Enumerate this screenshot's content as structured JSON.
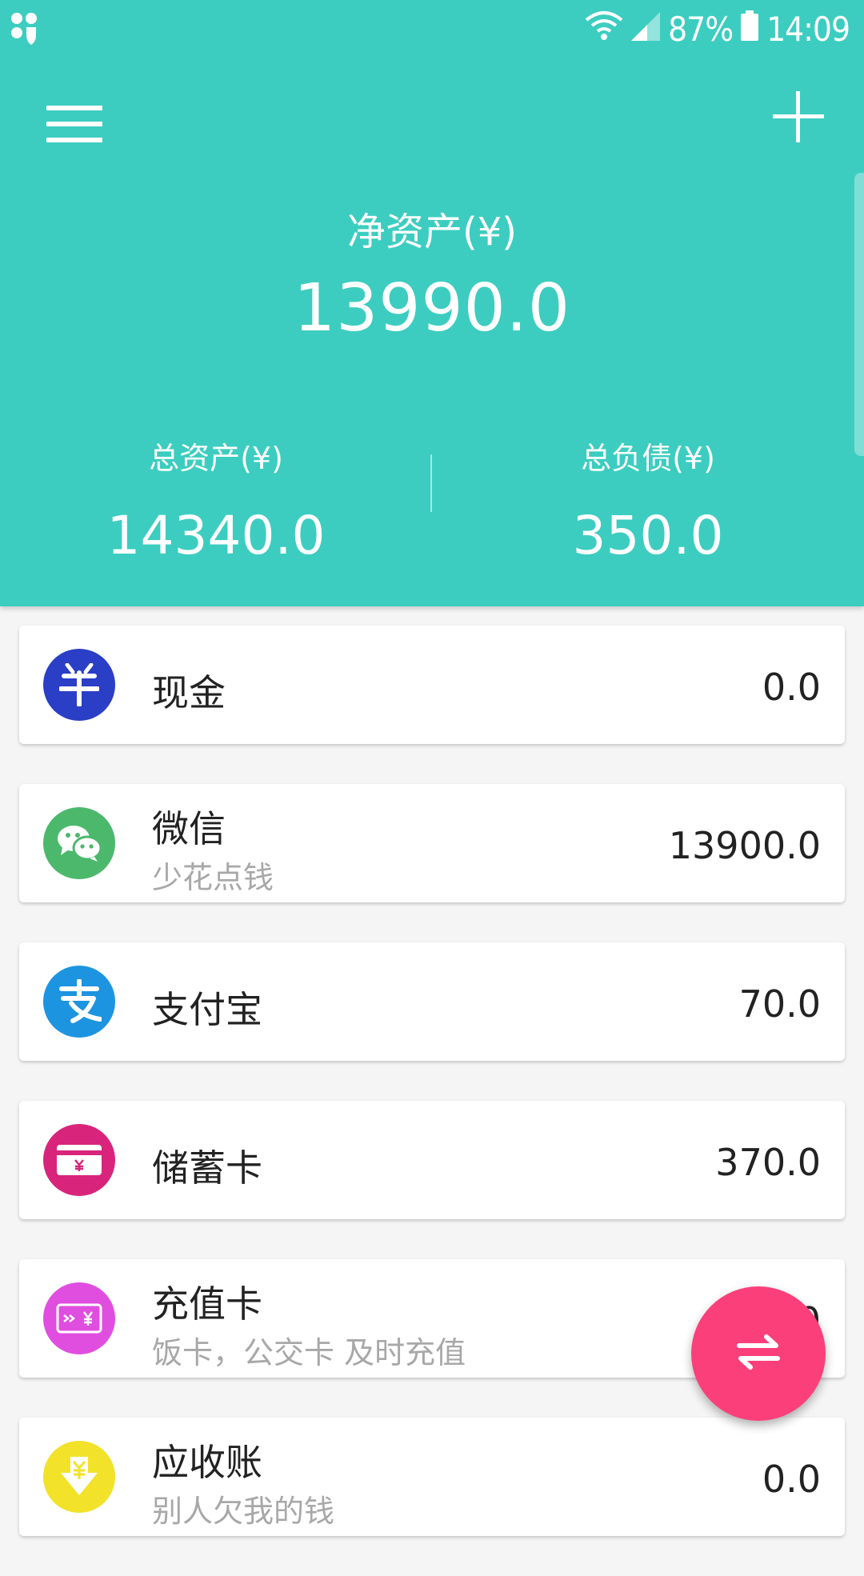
{
  "status_bar": {
    "battery_text": "87%",
    "time": "14:09",
    "icons": [
      "app-notification-icon",
      "wifi-icon",
      "signal-icon",
      "battery-icon"
    ]
  },
  "header": {
    "menu_icon": "hamburger-menu-icon",
    "add_icon": "plus-icon",
    "net_assets_label": "净资产(¥)",
    "net_assets_value": "13990.0",
    "total_assets_label": "总资产(¥)",
    "total_assets_value": "14340.0",
    "total_liabilities_label": "总负债(¥)",
    "total_liabilities_value": "350.0"
  },
  "accounts": [
    {
      "name": "现金",
      "desc": "",
      "amount": "0.0",
      "icon": "cash-icon",
      "color": "#2a3fc6"
    },
    {
      "name": "微信",
      "desc": "少花点钱",
      "amount": "13900.0",
      "icon": "wechat-icon",
      "color": "#4cb86c"
    },
    {
      "name": "支付宝",
      "desc": "",
      "amount": "70.0",
      "icon": "alipay-icon",
      "color": "#1d94e0"
    },
    {
      "name": "储蓄卡",
      "desc": "",
      "amount": "370.0",
      "icon": "debit-card-icon",
      "color": "#d8257b"
    },
    {
      "name": "充值卡",
      "desc": "饭卡，公交卡 及时充值",
      "amount": "0.0",
      "icon": "prepaid-card-icon",
      "color": "#e04ee0"
    },
    {
      "name": "应收账",
      "desc": "别人欠我的钱",
      "amount": "0.0",
      "icon": "receivable-icon",
      "color": "#f2e22a"
    }
  ],
  "fab": {
    "icon": "transfer-icon",
    "color": "#fb3f7a"
  }
}
